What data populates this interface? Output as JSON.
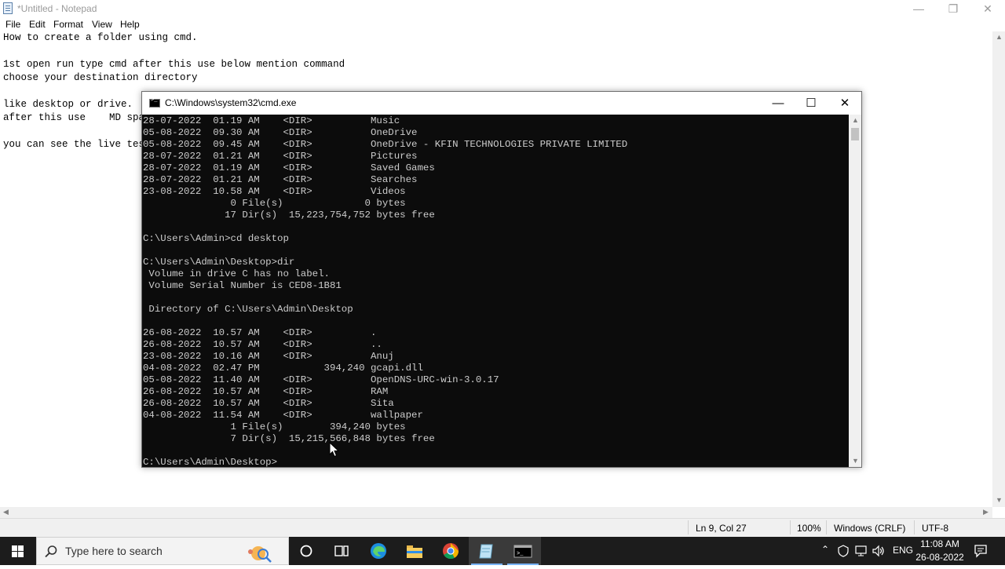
{
  "notepad": {
    "title": "*Untitled - Notepad",
    "menu": [
      "File",
      "Edit",
      "Format",
      "View",
      "Help"
    ],
    "lines": [
      "How to create a folder using cmd.",
      "",
      "1st open run type cmd after this use below mention command",
      "choose your destination directory",
      "",
      "like desktop or drive.",
      "after this use    MD spa",
      "",
      "you can see the live tes"
    ],
    "status": {
      "position": "Ln 9, Col 27",
      "zoom": "100%",
      "line_ending": "Windows (CRLF)",
      "encoding": "UTF-8"
    }
  },
  "cmd": {
    "title": "C:\\Windows\\system32\\cmd.exe",
    "lines": [
      "28-07-2022  01.19 AM    <DIR>          Music",
      "05-08-2022  09.30 AM    <DIR>          OneDrive",
      "05-08-2022  09.45 AM    <DIR>          OneDrive - KFIN TECHNOLOGIES PRIVATE LIMITED",
      "28-07-2022  01.21 AM    <DIR>          Pictures",
      "28-07-2022  01.19 AM    <DIR>          Saved Games",
      "28-07-2022  01.21 AM    <DIR>          Searches",
      "23-08-2022  10.58 AM    <DIR>          Videos",
      "               0 File(s)              0 bytes",
      "              17 Dir(s)  15,223,754,752 bytes free",
      "",
      "C:\\Users\\Admin>cd desktop",
      "",
      "C:\\Users\\Admin\\Desktop>dir",
      " Volume in drive C has no label.",
      " Volume Serial Number is CED8-1B81",
      "",
      " Directory of C:\\Users\\Admin\\Desktop",
      "",
      "26-08-2022  10.57 AM    <DIR>          .",
      "26-08-2022  10.57 AM    <DIR>          ..",
      "23-08-2022  10.16 AM    <DIR>          Anuj",
      "04-08-2022  02.47 PM           394,240 gcapi.dll",
      "05-08-2022  11.40 AM    <DIR>          OpenDNS-URC-win-3.0.17",
      "26-08-2022  10.57 AM    <DIR>          RAM",
      "26-08-2022  10.57 AM    <DIR>          Sita",
      "04-08-2022  11.54 AM    <DIR>          wallpaper",
      "               1 File(s)        394,240 bytes",
      "               7 Dir(s)  15,215,566,848 bytes free",
      "",
      "C:\\Users\\Admin\\Desktop>"
    ]
  },
  "taskbar": {
    "search_placeholder": "Type here to search",
    "language": "ENG",
    "time": "11:08 AM",
    "date": "26-08-2022",
    "accent": "#78b4ff"
  }
}
